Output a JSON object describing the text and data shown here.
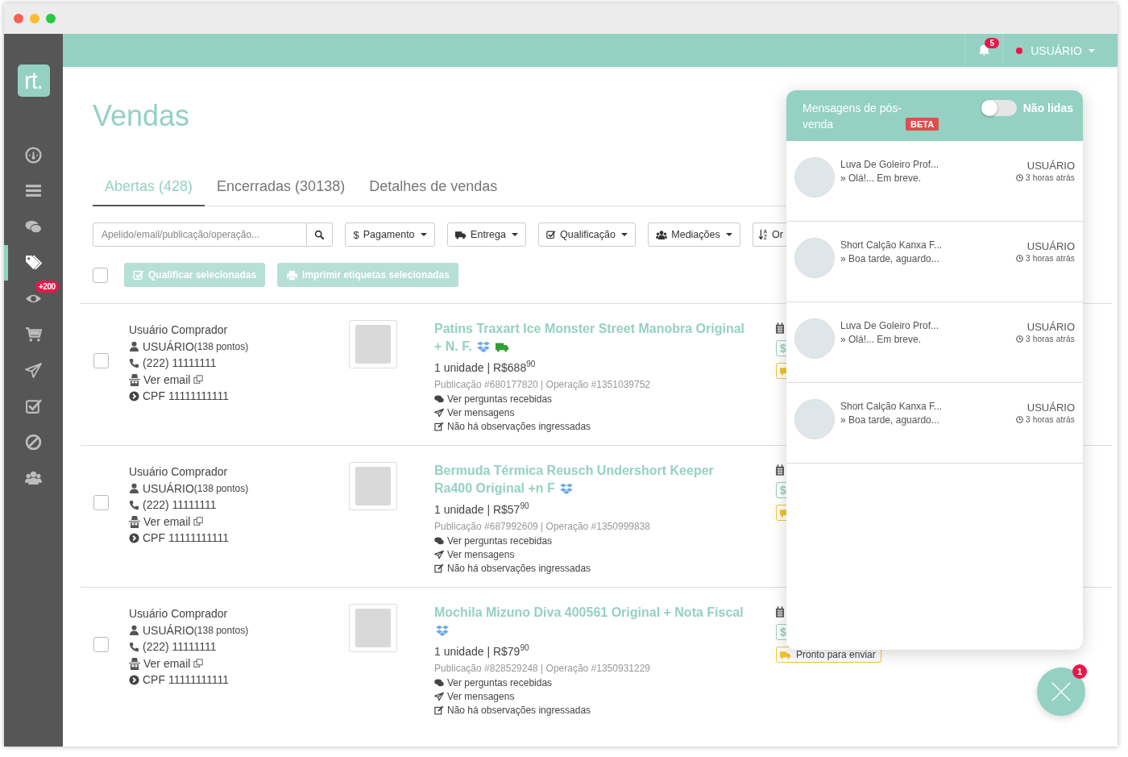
{
  "sidebar": {
    "logo": "rt.",
    "items": [
      {
        "kind": "dashboard",
        "selected": false
      },
      {
        "kind": "list",
        "selected": false
      },
      {
        "kind": "chat",
        "selected": false
      },
      {
        "kind": "tags",
        "selected": true
      },
      {
        "kind": "eye",
        "selected": false,
        "badge": "+200"
      },
      {
        "kind": "cart",
        "selected": false
      },
      {
        "kind": "send",
        "selected": false
      },
      {
        "kind": "check",
        "selected": false
      },
      {
        "kind": "ban",
        "selected": false
      },
      {
        "kind": "users",
        "selected": false
      }
    ]
  },
  "topbar": {
    "notifications": "5",
    "user": "USUÁRIO"
  },
  "page_title": "Vendas",
  "tabs": [
    {
      "label": "Abertas (428)",
      "selected": true
    },
    {
      "label": "Encerradas (30138)",
      "selected": false
    },
    {
      "label": "Detalhes de vendas",
      "selected": false
    }
  ],
  "search": {
    "placeholder": "Apelido/email/publicação/operação..."
  },
  "filters": [
    {
      "kind": "payment",
      "icon": "$",
      "label": "Pagamento"
    },
    {
      "kind": "shipping",
      "label": "Entrega"
    },
    {
      "kind": "rating",
      "label": "Qualificação"
    },
    {
      "kind": "mediation",
      "label": "Mediações"
    },
    {
      "kind": "sort",
      "label": "Or"
    }
  ],
  "select_all": {
    "checked": false
  },
  "bulk_actions": [
    {
      "kind": "rate",
      "label": "Qualificar selecionadas",
      "disabled": true
    },
    {
      "kind": "print",
      "label": "Imprimir etiquetas selecionadas",
      "disabled": true
    }
  ],
  "orders": [
    {
      "checked": false,
      "buyer": "Usuário Comprador",
      "nickname": "USUÁRIO",
      "points": "(138 pontos)",
      "phone": "(222) 11111111",
      "email": "Ver email",
      "cpf": "CPF 11111111111",
      "title": "Patins Traxart Ice Monster Street Manobra Original + N. F.",
      "fulfillment": true,
      "free_shipping": true,
      "price": "1 unidade | R$688$^{90}$",
      "refs": "Publicação #680177820 | Operação #1351039752",
      "questions": "Ver perguntas recebidas",
      "messages": "Ver mensagens",
      "notes": "Não há observações ingressadas",
      "status": [
        {
          "kind": "payment",
          "icon": "$"
        },
        {
          "kind": "shipping"
        }
      ]
    },
    {
      "checked": false,
      "buyer": "Usuário Comprador",
      "nickname": "USUÁRIO",
      "points": "(138 pontos)",
      "phone": "(222) 11111111",
      "email": "Ver email",
      "cpf": "CPF 11111111111",
      "title": "Bermuda Térmica Reusch Undershort Keeper Ra400 Original +n F",
      "fulfillment": true,
      "free_shipping": false,
      "price": "1 unidade | R$57$^{90}$",
      "refs": "Publicação #687992609 | Operação #1350999838",
      "questions": "Ver perguntas recebidas",
      "messages": "Ver mensagens",
      "notes": "Não há observações ingressadas",
      "status": [
        {
          "kind": "payment",
          "icon": "$"
        },
        {
          "kind": "shipping"
        }
      ]
    },
    {
      "checked": false,
      "buyer": "Usuário Comprador",
      "nickname": "USUÁRIO",
      "points": "(138 pontos)",
      "phone": "(222) 11111111",
      "email": "Ver email",
      "cpf": "CPF 11111111111",
      "title": "Mochila Mizuno Diva 400561 Original + Nota Fiscal",
      "fulfillment": true,
      "free_shipping": false,
      "price": "1 unidade | R$79$^{90}$",
      "refs": "Publicação #828529248 | Operação #1350931229",
      "questions": "Ver perguntas recebidas",
      "messages": "Ver mensagens",
      "notes": "Não há observações ingressadas",
      "status": [
        {
          "kind": "payment",
          "icon": "$"
        },
        {
          "kind": "shipping",
          "label": "Pronto para enviar"
        }
      ]
    }
  ],
  "messages_panel": {
    "title": "Mensagens de pós-venda",
    "badge": "BETA",
    "unread_filter": {
      "label": "Não lidas",
      "on": false
    },
    "threads": [
      {
        "product": "Luva De Goleiro Prof...",
        "preview": "» Olá!... Em breve.",
        "user": "USUÁRIO",
        "time": "3 horas atrás"
      },
      {
        "product": "Short Calção Kanxa F...",
        "preview": "» Boa tarde, aguardo...",
        "user": "USUÁRIO",
        "time": "3 horas atrás"
      },
      {
        "product": "Luva De Goleiro Prof...",
        "preview": "» Olá!... Em breve.",
        "user": "USUÁRIO",
        "time": "3 horas atrás"
      },
      {
        "product": "Short Calção Kanxa F...",
        "preview": "» Boa tarde, aguardo...",
        "user": "USUÁRIO",
        "time": "3 horas atrás"
      }
    ]
  },
  "chat_button": {
    "badge": "1"
  }
}
